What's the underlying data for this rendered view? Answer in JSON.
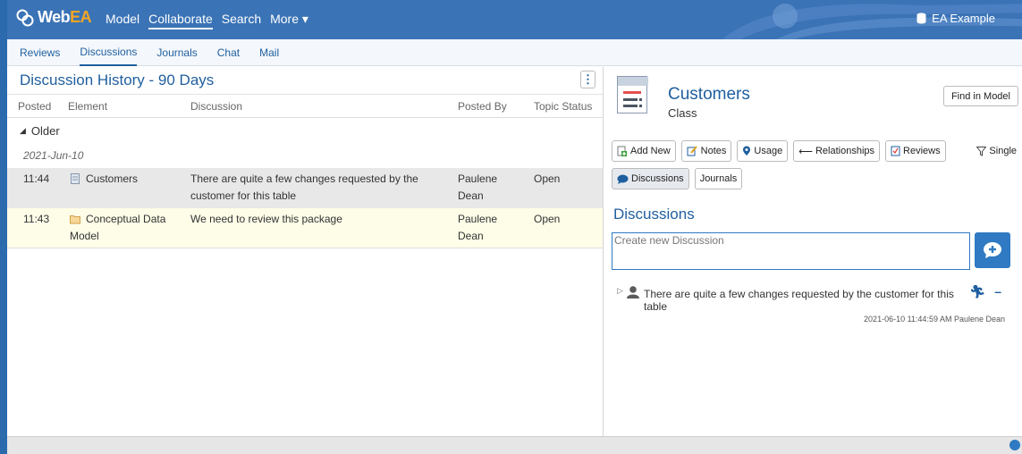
{
  "brand": {
    "web": "Web",
    "ea": "EA"
  },
  "topnav": {
    "items": [
      "Model",
      "Collaborate",
      "Search",
      "More ▾"
    ],
    "active": "Collaborate"
  },
  "model_name": "EA Example",
  "subnav": {
    "items": [
      "Reviews",
      "Discussions",
      "Journals",
      "Chat",
      "Mail"
    ],
    "active": "Discussions"
  },
  "history": {
    "title": "Discussion History - 90 Days",
    "columns": [
      "Posted",
      "Element",
      "Discussion",
      "Posted By",
      "Topic Status"
    ],
    "group": "Older",
    "date": "2021-Jun-10",
    "rows": [
      {
        "time": "11:44",
        "element": "Customers",
        "discussion": "There are quite a few changes requested by the customer for this table",
        "by": "Paulene Dean",
        "status": "Open"
      },
      {
        "time": "11:43",
        "element": "Conceptual Data Model",
        "discussion": "We need to review this package",
        "by": "Paulene Dean",
        "status": "Open"
      }
    ]
  },
  "element": {
    "name": "Customers",
    "type": "Class",
    "find_label": "Find in Model"
  },
  "tabs": {
    "add_new": "Add New",
    "notes": "Notes",
    "usage": "Usage",
    "relationships": "Relationships",
    "reviews": "Reviews",
    "discussions": "Discussions",
    "journals": "Journals",
    "single": "Single"
  },
  "discussions": {
    "heading": "Discussions",
    "placeholder": "Create new Discussion",
    "entry": {
      "text": "There are quite a few changes requested by the customer for this table",
      "meta": "2021-06-10 11:44:59 AM  Paulene Dean"
    }
  },
  "colors": {
    "accent": "#1f5f9f",
    "topbar": "#3a73b6",
    "brand_ea": "#f5a623"
  }
}
